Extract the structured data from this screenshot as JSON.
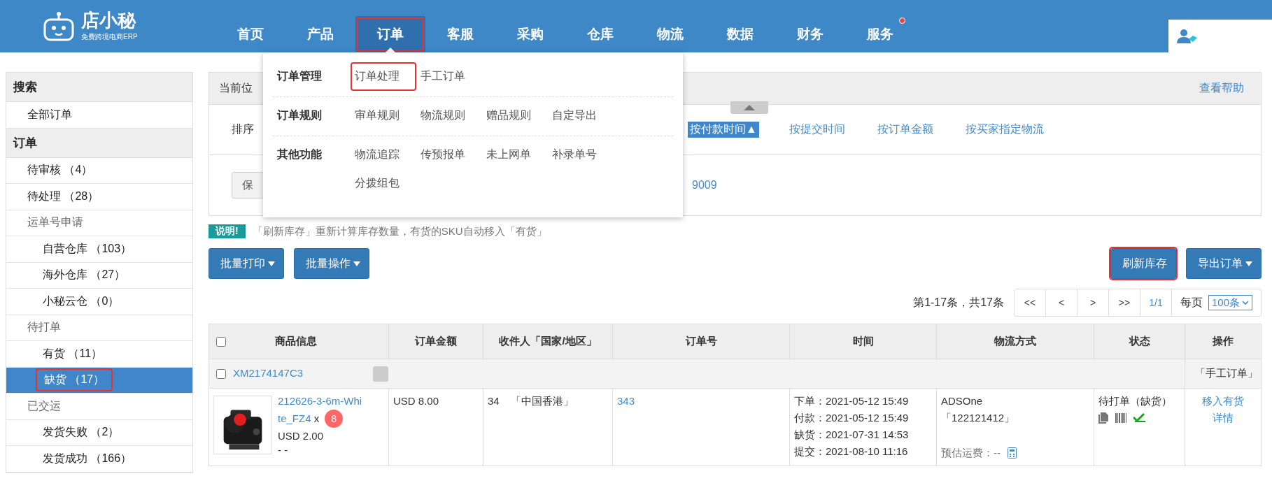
{
  "logo": {
    "name": "店小秘",
    "tagline": "免费跨境电商ERP"
  },
  "nav": [
    {
      "label": "首页",
      "selected": false,
      "highlighted": false,
      "badge": false
    },
    {
      "label": "产品",
      "selected": false,
      "highlighted": false,
      "badge": false
    },
    {
      "label": "订单",
      "selected": true,
      "highlighted": true,
      "badge": false
    },
    {
      "label": "客服",
      "selected": false,
      "highlighted": false,
      "badge": false
    },
    {
      "label": "采购",
      "selected": false,
      "highlighted": false,
      "badge": false
    },
    {
      "label": "仓库",
      "selected": false,
      "highlighted": false,
      "badge": false
    },
    {
      "label": "物流",
      "selected": false,
      "highlighted": false,
      "badge": false
    },
    {
      "label": "数据",
      "selected": false,
      "highlighted": false,
      "badge": false
    },
    {
      "label": "财务",
      "selected": false,
      "highlighted": false,
      "badge": false
    },
    {
      "label": "服务",
      "selected": false,
      "highlighted": false,
      "badge": true
    }
  ],
  "sidebar": [
    {
      "kind": "header",
      "label": "搜索"
    },
    {
      "kind": "item",
      "label": "全部订单",
      "selected": false,
      "highlighted": false
    },
    {
      "kind": "header",
      "label": "订单"
    },
    {
      "kind": "item",
      "label": "待审核",
      "count": "（4）",
      "selected": false,
      "highlighted": false
    },
    {
      "kind": "item",
      "label": "待处理",
      "count": "（28）",
      "selected": false,
      "highlighted": false
    },
    {
      "kind": "group",
      "label": "运单号申请",
      "children": [
        {
          "label": "自营仓库",
          "count": "（103）",
          "selected": false,
          "highlighted": false
        },
        {
          "label": "海外仓库",
          "count": "（27）",
          "selected": false,
          "highlighted": false
        },
        {
          "label": "小秘云仓",
          "count": "（0）",
          "selected": false,
          "highlighted": false
        }
      ]
    },
    {
      "kind": "group",
      "label": "待打单",
      "children": [
        {
          "label": "有货",
          "count": "（11）",
          "selected": false,
          "highlighted": false
        },
        {
          "label": "缺货",
          "count": "（17）",
          "selected": true,
          "highlighted": true
        }
      ]
    },
    {
      "kind": "group",
      "label": "已交运",
      "children": [
        {
          "label": "发货失败",
          "count": "（2）",
          "selected": false,
          "highlighted": false
        },
        {
          "label": "发货成功",
          "count": "（166）",
          "selected": false,
          "highlighted": false
        }
      ]
    }
  ],
  "dropdown": {
    "groups": [
      {
        "title": "订单管理",
        "links": [
          {
            "label": "订单处理",
            "highlighted": true
          },
          {
            "label": "手工订单",
            "highlighted": false
          }
        ]
      },
      {
        "title": "订单规则",
        "links": [
          {
            "label": "审单规则",
            "highlighted": false
          },
          {
            "label": "物流规则",
            "highlighted": false
          },
          {
            "label": "赠品规则",
            "highlighted": false
          },
          {
            "label": "自定导出",
            "highlighted": false
          }
        ]
      },
      {
        "title": "其他功能",
        "links": [
          {
            "label": "物流追踪",
            "highlighted": false
          },
          {
            "label": "传预报单",
            "highlighted": false
          },
          {
            "label": "未上网单",
            "highlighted": false
          },
          {
            "label": "补录单号",
            "highlighted": false
          },
          {
            "label": "分拨组包",
            "highlighted": false
          }
        ]
      }
    ]
  },
  "breadcrumb": {
    "location": "当前位",
    "help": "查看帮助"
  },
  "sort": {
    "label": "排序",
    "options": [
      {
        "label": "按付款时间▲",
        "selected": true
      },
      {
        "label": "按提交时间",
        "selected": false
      },
      {
        "label": "按订单金额",
        "selected": false
      },
      {
        "label": "按买家指定物流",
        "selected": false
      }
    ]
  },
  "saved_filters": {
    "button": "保",
    "link": "9009"
  },
  "notice": {
    "badge": "说明!",
    "text": "「刷新库存」重新计算库存数量，有货的SKU自动移入「有货」"
  },
  "actions_left": [
    {
      "label": "批量打印",
      "dropdown": true,
      "highlighted": false
    },
    {
      "label": "批量操作",
      "dropdown": true,
      "highlighted": false
    }
  ],
  "actions_right": [
    {
      "label": "刷新库存",
      "dropdown": false,
      "highlighted": true
    },
    {
      "label": "导出订单",
      "dropdown": true,
      "highlighted": false
    }
  ],
  "pagination": {
    "summary": "第1-17条，共17条",
    "pages": [
      "<<",
      "<",
      ">",
      ">>",
      "1/1"
    ],
    "per_page_label": "每页",
    "per_page": "100条"
  },
  "table": {
    "all_checked": false,
    "columns": [
      "商品信息",
      "订单金额",
      "收件人「国家/地区」",
      "订单号",
      "时间",
      "物流方式",
      "状态",
      "操作"
    ],
    "groups": [
      {
        "order_id": "XM2174147C3",
        "checked": false,
        "tag": "「手工订单」",
        "rows": [
          {
            "sku_lines": [
              "212626-3-6m-Whi",
              "te_FZ4"
            ],
            "times": "x",
            "qty": "8",
            "price": "USD 2.00",
            "extra": "- -",
            "amount": "USD 8.00",
            "receiver": "34",
            "country": "「中国香港」",
            "order_no": "343",
            "times_list": [
              "下单：2021-05-12 15:49",
              "付款：2021-05-12 15:49",
              "缺货：2021-07-31 14:53",
              "提交：2021-08-10 11:16"
            ],
            "logistics": "ADSOne",
            "tracking": "「122121412」",
            "fee": "预估运费：--",
            "status": "待打单（缺货）",
            "ops": [
              "移入有货",
              "详情"
            ]
          }
        ]
      }
    ]
  }
}
